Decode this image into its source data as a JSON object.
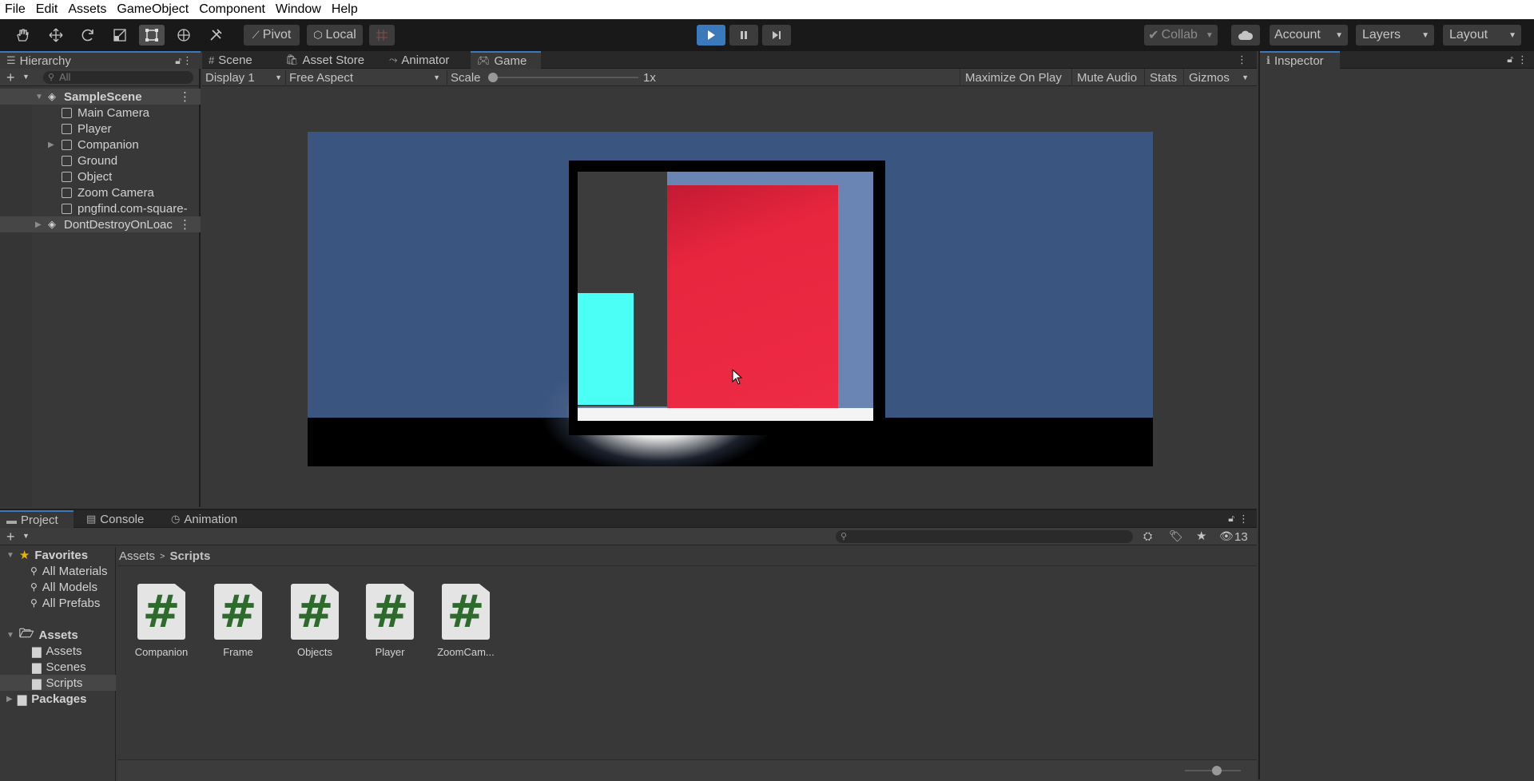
{
  "menu": [
    "File",
    "Edit",
    "Assets",
    "GameObject",
    "Component",
    "Window",
    "Help"
  ],
  "toolbar": {
    "tools": [
      "hand-icon",
      "move-icon",
      "rotate-icon",
      "scale-icon",
      "rect-icon",
      "transform-icon",
      "custom-tool-icon"
    ],
    "pivot": "Pivot",
    "local": "Local",
    "collab": "Collab",
    "account": "Account",
    "layers": "Layers",
    "layout": "Layout"
  },
  "hierarchy": {
    "tab": "Hierarchy",
    "search_placeholder": "All",
    "items": [
      {
        "label": "SampleScene",
        "type": "scene"
      },
      {
        "label": "Main Camera"
      },
      {
        "label": "Player"
      },
      {
        "label": "Companion"
      },
      {
        "label": "Ground"
      },
      {
        "label": "Object"
      },
      {
        "label": "Zoom Camera"
      },
      {
        "label": "pngfind.com-square-"
      },
      {
        "label": "DontDestroyOnLoac",
        "type": "scene"
      }
    ]
  },
  "center_tabs": [
    "Scene",
    "Asset Store",
    "Animator",
    "Game"
  ],
  "game_bar": {
    "display": "Display 1",
    "aspect": "Free Aspect",
    "scale_label": "Scale",
    "scale_value": "1x",
    "maximize": "Maximize On Play",
    "mute": "Mute Audio",
    "stats": "Stats",
    "gizmos": "Gizmos"
  },
  "inspector": {
    "tab": "Inspector"
  },
  "bottom_tabs": [
    "Project",
    "Console",
    "Animation"
  ],
  "project": {
    "favorites_label": "Favorites",
    "favorites": [
      "All Materials",
      "All Models",
      "All Prefabs"
    ],
    "assets_label": "Assets",
    "asset_folders": [
      "Assets",
      "Scenes",
      "Scripts"
    ],
    "packages_label": "Packages",
    "breadcrumb": [
      "Assets",
      "Scripts"
    ],
    "hidden_count": "13",
    "scripts": [
      "Companion",
      "Frame",
      "Objects",
      "Player",
      "ZoomCam..."
    ]
  },
  "colors": {
    "sky": "#3a5580",
    "red": "#e8263e",
    "cyan": "#4cfff6",
    "accent": "#3a79bb"
  }
}
